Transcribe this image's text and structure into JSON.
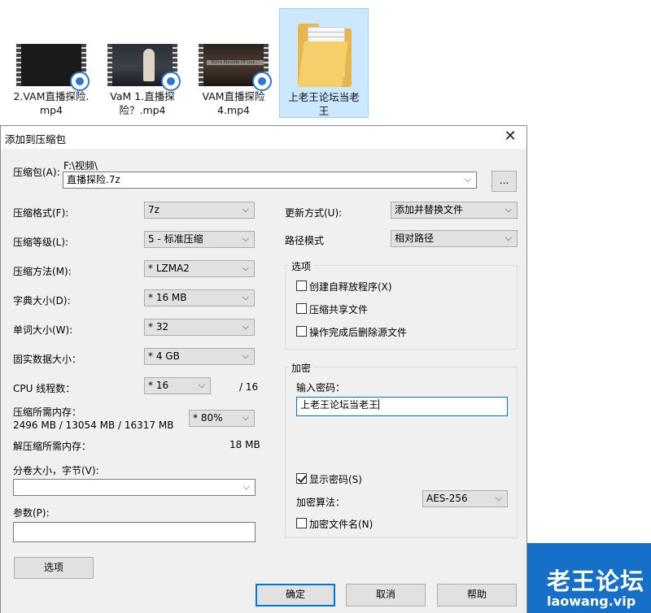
{
  "explorer": {
    "files": [
      {
        "label_line1": "2.VAM直播探险.",
        "label_line2": "mp4"
      },
      {
        "label_line1": "VaM 1.直播探",
        "label_line2": "险？.mp4"
      },
      {
        "label_line1": "VAM直播探险",
        "label_line2": "4.mp4",
        "thumb_text": "Extra Episode Of Live..."
      },
      {
        "label_line1": "上老王论坛当老",
        "label_line2": "王"
      }
    ]
  },
  "watermark": {
    "title": "老王论坛",
    "subtitle": "laowang.vip"
  },
  "dialog": {
    "title": "添加到压缩包",
    "archive": {
      "label": "压缩包(A):",
      "path": "F:\\视频\\",
      "filename": "直播探险.7z",
      "browse_label": "..."
    },
    "format": {
      "label": "压缩格式(F):",
      "value": "7z"
    },
    "level": {
      "label": "压缩等级(L):",
      "value": "5 - 标准压缩"
    },
    "method": {
      "label": "压缩方法(M):",
      "value": "* LZMA2"
    },
    "dict": {
      "label": "字典大小(D):",
      "value": "* 16 MB"
    },
    "word": {
      "label": "单词大小(W):",
      "value": "* 32"
    },
    "solid": {
      "label": "固实数据大小：",
      "value": "* 4 GB"
    },
    "threads": {
      "label": "CPU 线程数：",
      "value": "* 16",
      "max": "/ 16"
    },
    "mem_comp": {
      "label": "压缩所需内存：",
      "detail": "2496 MB / 13054 MB / 16317 MB",
      "value": "* 80%"
    },
    "mem_decomp": {
      "label": "解压缩所需内存：",
      "value": "18 MB"
    },
    "volume": {
      "label": "分卷大小，字节(V):",
      "value": ""
    },
    "params": {
      "label": "参数(P):",
      "value": ""
    },
    "options_button": "选项",
    "update_mode": {
      "label": "更新方式(U):",
      "value": "添加并替换文件"
    },
    "path_mode": {
      "label": "路径模式",
      "value": "相对路径"
    },
    "options_group": {
      "title": "选项",
      "sfx": {
        "label": "创建自释放程序(X)",
        "checked": false
      },
      "shared": {
        "label": "压缩共享文件",
        "checked": false
      },
      "delete": {
        "label": "操作完成后删除源文件",
        "checked": false
      }
    },
    "encryption": {
      "title": "加密",
      "password_label": "输入密码：",
      "password_value": "上老王论坛当老王",
      "show_password": {
        "label": "显示密码(S)",
        "checked": true
      },
      "method_label": "加密算法：",
      "method_value": "AES-256",
      "encrypt_names": {
        "label": "加密文件名(N)",
        "checked": false
      }
    },
    "buttons": {
      "ok": "确定",
      "cancel": "取消",
      "help": "帮助"
    },
    "close_glyph": "✕"
  },
  "colors": {
    "accent": "#0078d7",
    "selection": "#cce8ff",
    "watermark_bg": "#1670c8"
  }
}
